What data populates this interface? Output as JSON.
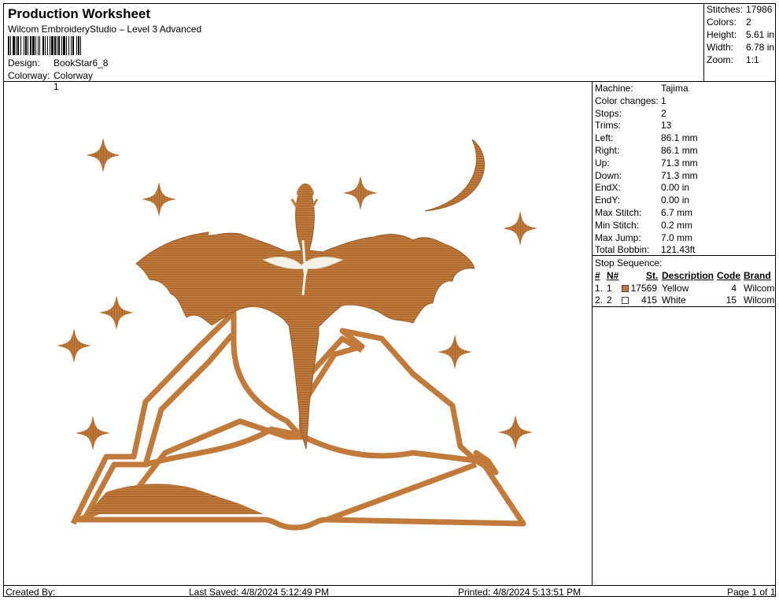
{
  "header": {
    "title": "Production Worksheet",
    "subtitle": "Wilcom EmbroideryStudio – Level 3 Advanced",
    "design_label": "Design:",
    "design_value": "BookStar6_8",
    "colorway_label": "Colorway:",
    "colorway_value": "Colorway 1"
  },
  "stats": {
    "stitches_label": "Stitches:",
    "stitches": "17986",
    "colors_label": "Colors:",
    "colors": "2",
    "height_label": "Height:",
    "height": "5.61 in",
    "width_label": "Width:",
    "width": "6.78 in",
    "zoom_label": "Zoom:",
    "zoom": "1:1"
  },
  "machine_info": [
    {
      "label": "Machine:",
      "value": "Tajima"
    },
    {
      "label": "Color changes:",
      "value": "1"
    },
    {
      "label": "Stops:",
      "value": "2"
    },
    {
      "label": "Trims:",
      "value": "13"
    },
    {
      "label": "Left:",
      "value": "86.1 mm"
    },
    {
      "label": "Right:",
      "value": "86.1 mm"
    },
    {
      "label": "Up:",
      "value": "71.3 mm"
    },
    {
      "label": "Down:",
      "value": "71.3 mm"
    },
    {
      "label": "EndX:",
      "value": "0.00 in"
    },
    {
      "label": "EndY:",
      "value": "0.00 in"
    },
    {
      "label": "Max Stitch:",
      "value": "6.7 mm"
    },
    {
      "label": "Min Stitch:",
      "value": "0.2 mm"
    },
    {
      "label": "Max Jump:",
      "value": "7.0 mm"
    },
    {
      "label": "Total Bobbin:",
      "value": "121.43ft"
    }
  ],
  "stop_sequence": {
    "title": "Stop Sequence:",
    "headers": {
      "num": "#",
      "n": "N#",
      "st": "St.",
      "desc": "Description",
      "code": "Code",
      "brand": "Brand"
    },
    "rows": [
      {
        "num": "1.",
        "n": "1",
        "color": "#c17a3a",
        "st": "17569",
        "desc": "Yellow",
        "code": "4",
        "brand": "Wilcom"
      },
      {
        "num": "2.",
        "n": "2",
        "color": "#ffffff",
        "st": "415",
        "desc": "White",
        "code": "15",
        "brand": "Wilcom"
      }
    ]
  },
  "footer": {
    "created": "Created By:",
    "saved": "Last Saved: 4/8/2024 5:12:49 PM",
    "printed": "Printed: 4/8/2024 5:13:51 PM",
    "page": "Page 1 of 1"
  },
  "colors": {
    "thread_main": "#c17a3a",
    "thread_shadow": "#8e5424",
    "thread_white": "#f3f1e8"
  }
}
